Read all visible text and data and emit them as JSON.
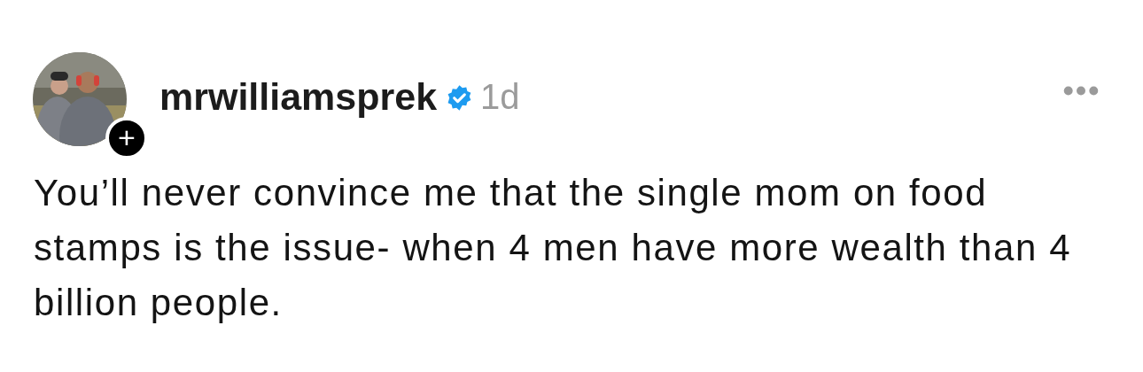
{
  "post": {
    "author": "mrwilliamsprek",
    "verified": true,
    "time": "1d",
    "avatar": {
      "kind": "picture",
      "follow_badge": "+"
    },
    "text": "You’ll never convince me that the single mom on food stamps is the issue- when 4 men have more wealth than 4 billion people."
  }
}
